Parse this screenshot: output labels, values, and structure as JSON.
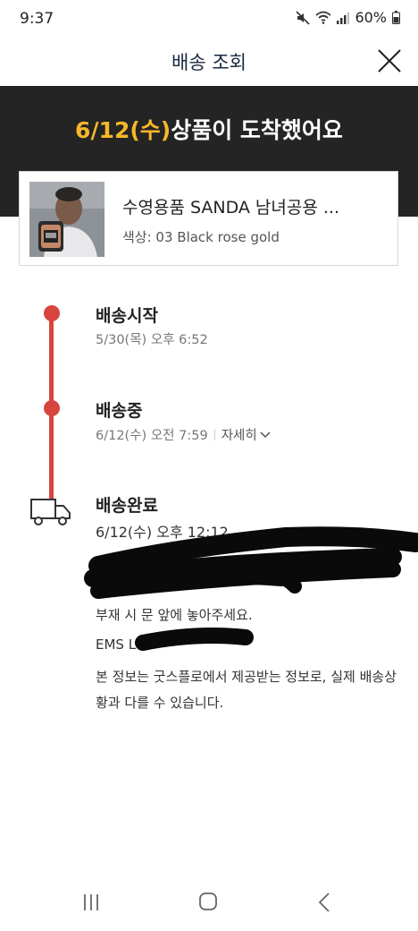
{
  "status_bar": {
    "time": "9:37",
    "battery": "60%",
    "icons": [
      "mute-icon",
      "wifi-icon",
      "signal-icon",
      "battery-icon"
    ]
  },
  "header": {
    "title": "배송 조회",
    "close_icon": "close-icon"
  },
  "banner": {
    "date": "6/12(수)",
    "message": "상품이 도착했어요",
    "colors": {
      "background": "#242424",
      "highlight": "#f6b72a"
    }
  },
  "product": {
    "name": "수영용품 SANDA 남녀공용 ...",
    "option": "색상: 03 Black rose gold"
  },
  "timeline": {
    "accent_color": "#d8453e",
    "steps": [
      {
        "title": "배송시작",
        "time": "5/30(목) 오후 6:52"
      },
      {
        "title": "배송중",
        "time": "6/12(수) 오전 7:59",
        "detail_label": "자세히"
      },
      {
        "title": "배송완료",
        "time": "6/12(수) 오후 12:12"
      }
    ],
    "notes": {
      "line1": "부재 시 문 앞에 놓아주세요.",
      "line2_prefix": "EMS L",
      "info": "본 정보는 굿스플로에서 제공받는 정보로, 실제 배송상황과 다를 수 있습니다."
    }
  },
  "nav_bar": {
    "recent_icon": "recent-apps-icon",
    "home_icon": "home-icon",
    "back_icon": "back-icon"
  }
}
